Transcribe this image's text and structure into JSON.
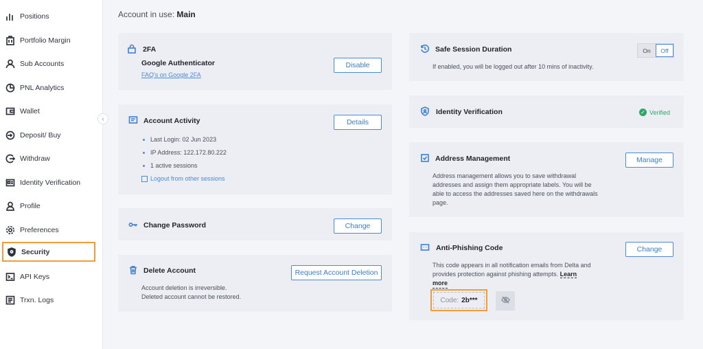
{
  "sidebar": {
    "items": [
      {
        "label": "Positions",
        "icon": "bar-chart-icon"
      },
      {
        "label": "Portfolio Margin",
        "icon": "building-icon"
      },
      {
        "label": "Sub Accounts",
        "icon": "user-icon"
      },
      {
        "label": "PNL Analytics",
        "icon": "pie-chart-icon"
      },
      {
        "label": "Wallet",
        "icon": "wallet-icon"
      },
      {
        "label": "Deposit/ Buy",
        "icon": "deposit-icon"
      },
      {
        "label": "Withdraw",
        "icon": "withdraw-icon"
      },
      {
        "label": "Identity Verification",
        "icon": "id-card-icon"
      },
      {
        "label": "Profile",
        "icon": "profile-icon"
      },
      {
        "label": "Preferences",
        "icon": "gear-icon"
      },
      {
        "label": "Security",
        "icon": "shield-icon",
        "active": true
      },
      {
        "label": "API Keys",
        "icon": "terminal-icon"
      },
      {
        "label": "Trxn. Logs",
        "icon": "log-icon"
      }
    ]
  },
  "header": {
    "prefix": "Account in use:",
    "account": "Main"
  },
  "twofa": {
    "title": "2FA",
    "method": "Google Authenticator",
    "faq_link": "FAQ's on Google 2FA",
    "button": "Disable"
  },
  "activity": {
    "title": "Account Activity",
    "button": "Details",
    "last_login": "Last Login: 02 Jun 2023",
    "ip": "IP Address: 122.172.80.222",
    "sessions": "1 active sessions",
    "logout_link": "Logout from other sessions"
  },
  "password": {
    "title": "Change Password",
    "button": "Change"
  },
  "delete": {
    "title": "Delete Account",
    "button": "Request Account Deletion",
    "line1": "Account deletion is irreversible.",
    "line2": "Deleted account cannot be restored."
  },
  "session": {
    "title": "Safe Session Duration",
    "desc": "If enabled, you will be logged out after 10 mins of inactivity.",
    "on": "On",
    "off": "Off",
    "selected": "Off"
  },
  "identity": {
    "title": "Identity Verification",
    "status": "Verified"
  },
  "address": {
    "title": "Address Management",
    "button": "Manage",
    "desc1": "Address management allows you to save withdrawal",
    "desc2": "addresses and assign them appropriate labels. You will be",
    "desc3": "able to access the addresses saved here on the withdrawals",
    "desc4": "page."
  },
  "phishing": {
    "title": "Anti-Phishing Code",
    "button": "Change",
    "desc1": "This code appears in all notification emails from Delta and",
    "desc2": "provides protection against phishing attempts.",
    "learn1": "Learn",
    "learn2": "more",
    "code_label": "Code:",
    "code_value": "2b***"
  },
  "colors": {
    "accent": "#4a8ad8",
    "highlight": "#f39b34",
    "verified": "#2ea66a",
    "card_bg": "#eceef4"
  }
}
